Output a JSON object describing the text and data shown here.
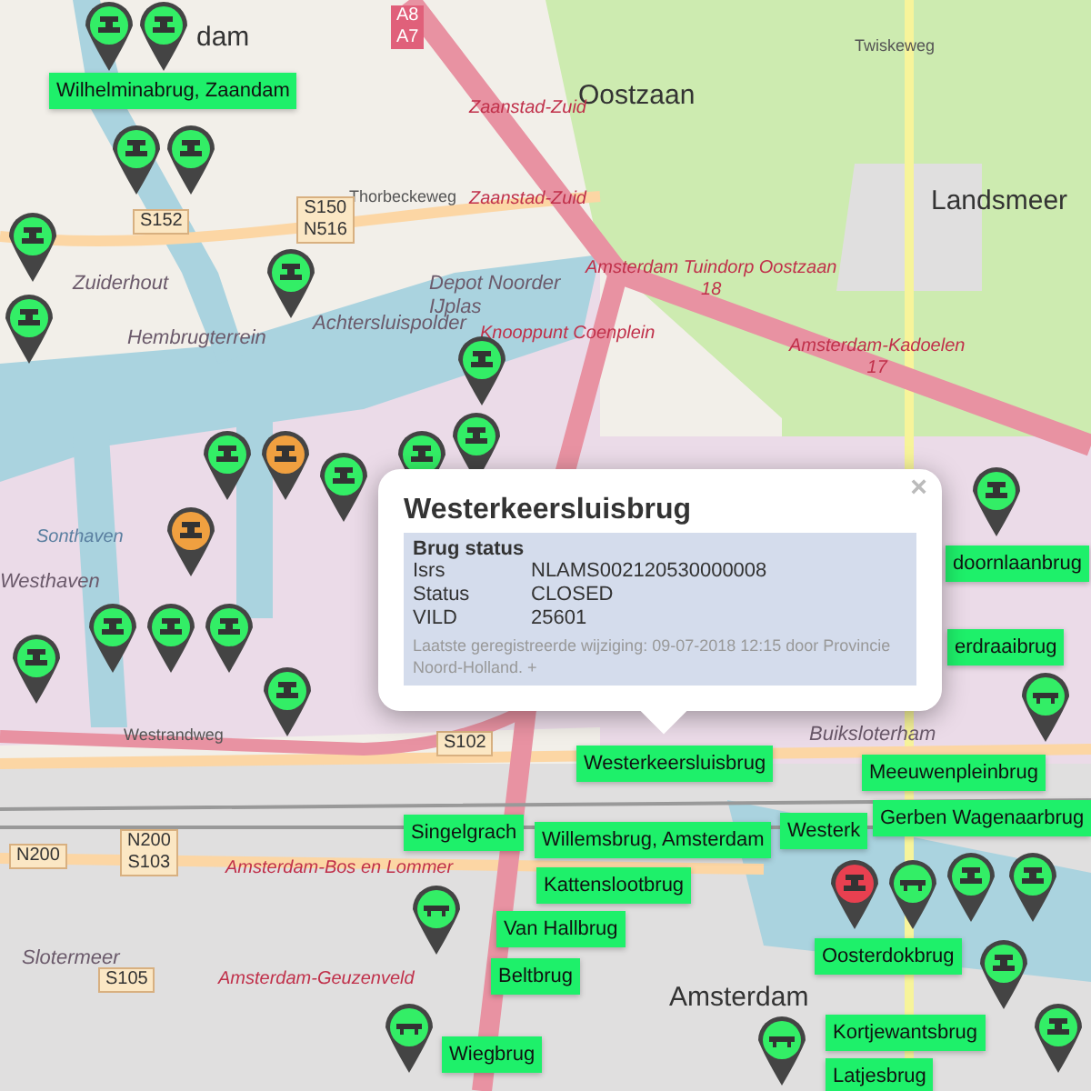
{
  "map": {
    "labels": [
      {
        "text": "dam",
        "kind": "place"
      },
      {
        "text": "Oostzaan",
        "kind": "place"
      },
      {
        "text": "Landsmeer",
        "kind": "place"
      },
      {
        "text": "Zaanstad-Zuid",
        "kind": "exit"
      },
      {
        "text": "Zaanstad-Zuid",
        "kind": "exit"
      },
      {
        "text": "Twiskeweg",
        "kind": "street"
      },
      {
        "text": "Thorbeckeweg",
        "kind": "street"
      },
      {
        "text": "S150\nN516",
        "kind": "shield"
      },
      {
        "text": "S152",
        "kind": "shield"
      },
      {
        "text": "A8\nA7",
        "kind": "motorway"
      },
      {
        "text": "Zuiderhout",
        "kind": "district"
      },
      {
        "text": "Hembrugterrein",
        "kind": "district"
      },
      {
        "text": "Achtersluispolder",
        "kind": "district"
      },
      {
        "text": "Depot Noorder\nIJplas",
        "kind": "district"
      },
      {
        "text": "Knooppunt Coenplein",
        "kind": "exit"
      },
      {
        "text": "Amsterdam Tuindorp Oostzaan\n18",
        "kind": "exit"
      },
      {
        "text": "Amsterdam-Kadoelen\n17",
        "kind": "exit"
      },
      {
        "text": "Sonthaven",
        "kind": "water"
      },
      {
        "text": "Westhaven",
        "kind": "district"
      },
      {
        "text": "Westrandweg",
        "kind": "street"
      },
      {
        "text": "S102",
        "kind": "shield"
      },
      {
        "text": "N200",
        "kind": "shield"
      },
      {
        "text": "N200\nS103",
        "kind": "shield"
      },
      {
        "text": "Amsterdam-Bos en Lommer",
        "kind": "exit"
      },
      {
        "text": "Slotermeer",
        "kind": "district"
      },
      {
        "text": "S105",
        "kind": "shield"
      },
      {
        "text": "Amsterdam-Geuzenveld",
        "kind": "exit"
      },
      {
        "text": "Buiksloterham",
        "kind": "district"
      },
      {
        "text": "Amsterdam",
        "kind": "place"
      }
    ]
  },
  "markers": [
    {
      "kind": "bascule",
      "color": "#33ee66"
    },
    {
      "kind": "bascule",
      "color": "#33ee66"
    },
    {
      "kind": "bascule",
      "color": "#33ee66"
    },
    {
      "kind": "bascule",
      "color": "#33ee66"
    },
    {
      "kind": "bascule",
      "color": "#33ee66"
    },
    {
      "kind": "bascule",
      "color": "#33ee66"
    },
    {
      "kind": "bascule",
      "color": "#33ee66"
    },
    {
      "kind": "bascule",
      "color": "#33ee66"
    },
    {
      "kind": "bascule",
      "color": "#33ee66"
    },
    {
      "kind": "bascule",
      "color": "#33ee66"
    },
    {
      "kind": "bascule",
      "color": "#33ee66"
    },
    {
      "kind": "bascule",
      "color": "#f0a040"
    },
    {
      "kind": "bascule",
      "color": "#33ee66"
    },
    {
      "kind": "bascule",
      "color": "#f0a040"
    },
    {
      "kind": "bascule",
      "color": "#33ee66"
    },
    {
      "kind": "bascule",
      "color": "#33ee66"
    },
    {
      "kind": "bascule",
      "color": "#33ee66"
    },
    {
      "kind": "bascule",
      "color": "#33ee66"
    },
    {
      "kind": "bascule",
      "color": "#33ee66"
    },
    {
      "kind": "bascule",
      "color": "#33ee66"
    },
    {
      "kind": "flat",
      "color": "#33ee66"
    },
    {
      "kind": "bascule",
      "color": "#e84050"
    },
    {
      "kind": "flat",
      "color": "#33ee66"
    },
    {
      "kind": "bascule",
      "color": "#33ee66"
    },
    {
      "kind": "bascule",
      "color": "#33ee66"
    },
    {
      "kind": "bascule",
      "color": "#33ee66"
    },
    {
      "kind": "bascule",
      "color": "#33ee66"
    },
    {
      "kind": "flat",
      "color": "#33ee66"
    },
    {
      "kind": "flat",
      "color": "#33ee66"
    },
    {
      "kind": "flat",
      "color": "#33ee66"
    }
  ],
  "bridge_labels": [
    "Wilhelminabrug, Zaandam",
    "doornlaanbrug",
    "erdraaibrug",
    "Westerkeersluisbrug",
    "Meeuwenpleinbrug",
    "Singelgrach",
    "Westerk",
    "Gerben Wagenaarbrug",
    "Willemsbrug, Amsterdam",
    "Kattenslootbrug",
    "Van Hallbrug",
    "Oosterdokbrug",
    "Beltbrug",
    "Kortjewantsbrug",
    "Wiegbrug",
    "Latjesbrug"
  ],
  "popup": {
    "title": "Westerkeersluisbrug",
    "close": "×",
    "section": "Brug status",
    "rows": [
      {
        "key": "Isrs",
        "value": "NLAMS002120530000008"
      },
      {
        "key": "Status",
        "value": "CLOSED"
      },
      {
        "key": "VILD",
        "value": "25601"
      }
    ],
    "note": "Laatste geregistreerde wijziging: 09-07-2018 12:15 door Provincie Noord-Holland. +"
  }
}
